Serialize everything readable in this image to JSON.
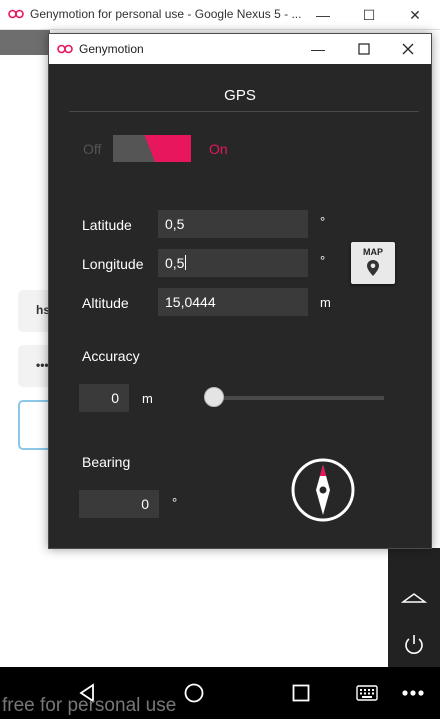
{
  "background": {
    "window_title": "Genymotion for personal use - Google Nexus 5 - ...",
    "field1_text": "hs",
    "field2_text": "•••",
    "watermark": "free for personal use"
  },
  "dialog": {
    "window_title": "Genymotion",
    "section_title": "GPS",
    "toggle": {
      "off_label": "Off",
      "on_label": "On",
      "state": "on"
    },
    "latitude": {
      "label": "Latitude",
      "value": "0,5",
      "unit": "°"
    },
    "longitude": {
      "label": "Longitude",
      "value": "0,5",
      "unit": "°"
    },
    "altitude": {
      "label": "Altitude",
      "value": "15,0444",
      "unit": "m"
    },
    "map_button_label": "MAP",
    "accuracy": {
      "label": "Accuracy",
      "value": "0",
      "unit": "m",
      "slider_fraction": 0
    },
    "bearing": {
      "label": "Bearing",
      "value": "0",
      "unit": "°"
    }
  },
  "colors": {
    "accent": "#e8175d",
    "dialog_bg": "#272727",
    "field_bg": "#3a3a3a"
  },
  "icons": [
    "genymotion-logo-icon",
    "minimize-icon",
    "maximize-icon",
    "close-icon",
    "map-pin-icon",
    "compass-icon",
    "back-icon",
    "home-icon",
    "recents-icon",
    "keyboard-icon",
    "more-icon",
    "power-icon"
  ]
}
